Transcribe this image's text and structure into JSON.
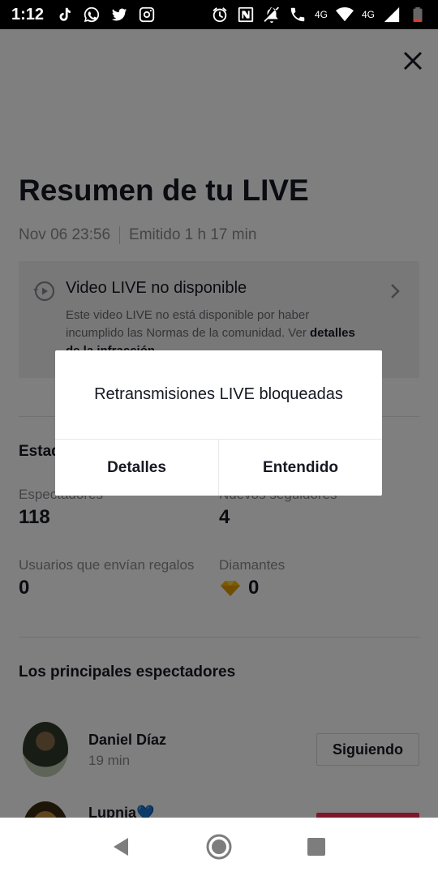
{
  "status_bar": {
    "time": "1:12",
    "network_label": "4G",
    "lte_label": "4G",
    "icons_left": [
      "tiktok-icon",
      "whatsapp-icon",
      "twitter-icon",
      "instagram-icon"
    ],
    "icons_right": [
      "alarm-icon",
      "nfc-icon",
      "mute-icon",
      "call-icon",
      "wifi-icon",
      "signal-icon",
      "battery-icon"
    ]
  },
  "page": {
    "title": "Resumen de tu LIVE",
    "date": "Nov 06 23:56",
    "duration": "Emitido 1 h 17 min"
  },
  "notice": {
    "title": "Video LIVE no disponible",
    "body": "Este video LIVE no está disponible por haber incumplido las Normas de la comunidad. Ver",
    "link": "detalles de la infracción"
  },
  "stats": {
    "section_title": "Estadísticas",
    "viewers_label": "Espectadores",
    "viewers_value": "118",
    "followers_label": "Nuevos seguidores",
    "followers_value": "4",
    "gifters_label": "Usuarios que envían regalos",
    "gifters_value": "0",
    "diamonds_label": "Diamantes",
    "diamonds_value": "0"
  },
  "top_viewers": {
    "section_title": "Los principales espectadores",
    "items": [
      {
        "name": "Daniel Díaz",
        "time": "19 min",
        "button": "Siguiendo"
      },
      {
        "name": "Lupnia💙",
        "time": "",
        "button": ""
      }
    ]
  },
  "dialog": {
    "message": "Retransmisiones LIVE bloqueadas",
    "left_button": "Detalles",
    "right_button": "Entendido"
  },
  "colors": {
    "overlay": "#000000",
    "accent_red": "#fe2c55",
    "diamond": "#f5b700"
  }
}
